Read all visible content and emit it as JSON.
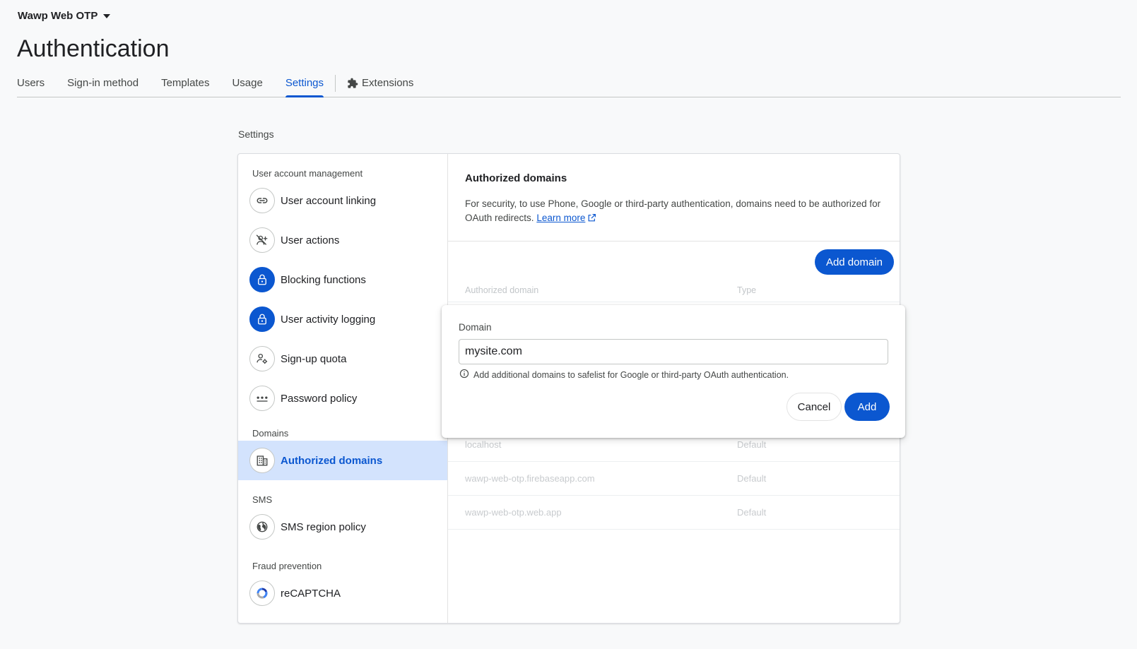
{
  "header": {
    "project_name": "Wawp Web OTP",
    "page_title": "Authentication"
  },
  "tabs": [
    {
      "label": "Users"
    },
    {
      "label": "Sign-in method"
    },
    {
      "label": "Templates"
    },
    {
      "label": "Usage"
    },
    {
      "label": "Settings",
      "active": true
    },
    {
      "label": "Extensions"
    }
  ],
  "section_heading": "Settings",
  "sidebar": {
    "groups": [
      {
        "title": "User account management",
        "items": [
          {
            "label": "User account linking",
            "icon": "link-icon"
          },
          {
            "label": "User actions",
            "icon": "user-off-icon"
          },
          {
            "label": "Blocking functions",
            "icon": "lock-icon"
          },
          {
            "label": "User activity logging",
            "icon": "lock-icon"
          },
          {
            "label": "Sign-up quota",
            "icon": "user-settings-icon"
          },
          {
            "label": "Password policy",
            "icon": "password-dots-icon"
          }
        ]
      },
      {
        "title": "Domains",
        "items": [
          {
            "label": "Authorized domains",
            "icon": "building-icon",
            "active": true
          }
        ]
      },
      {
        "title": "SMS",
        "items": [
          {
            "label": "SMS region policy",
            "icon": "globe-icon"
          }
        ]
      },
      {
        "title": "Fraud prevention",
        "items": [
          {
            "label": "reCAPTCHA",
            "icon": "recaptcha-icon"
          }
        ]
      }
    ]
  },
  "panel": {
    "title": "Authorized domains",
    "description": "For security, to use Phone, Google or third-party authentication, domains need to be authorized for OAuth redirects.",
    "learn_more": "Learn more",
    "add_domain_label": "Add domain",
    "table": {
      "headers": [
        "Authorized domain",
        "Type"
      ],
      "rows": [
        [
          "localhost",
          "Default"
        ],
        [
          "wawp-web-otp.firebaseapp.com",
          "Default"
        ],
        [
          "wawp-web-otp.web.app",
          "Default"
        ]
      ]
    }
  },
  "dialog": {
    "field_label": "Domain",
    "field_value": "mysite.com",
    "hint": "Add additional domains to safelist for Google or third-party OAuth authentication.",
    "cancel_label": "Cancel",
    "add_label": "Add"
  },
  "colors": {
    "accent": "#0b57d0",
    "active_nav_bg": "#d3e3fd"
  }
}
